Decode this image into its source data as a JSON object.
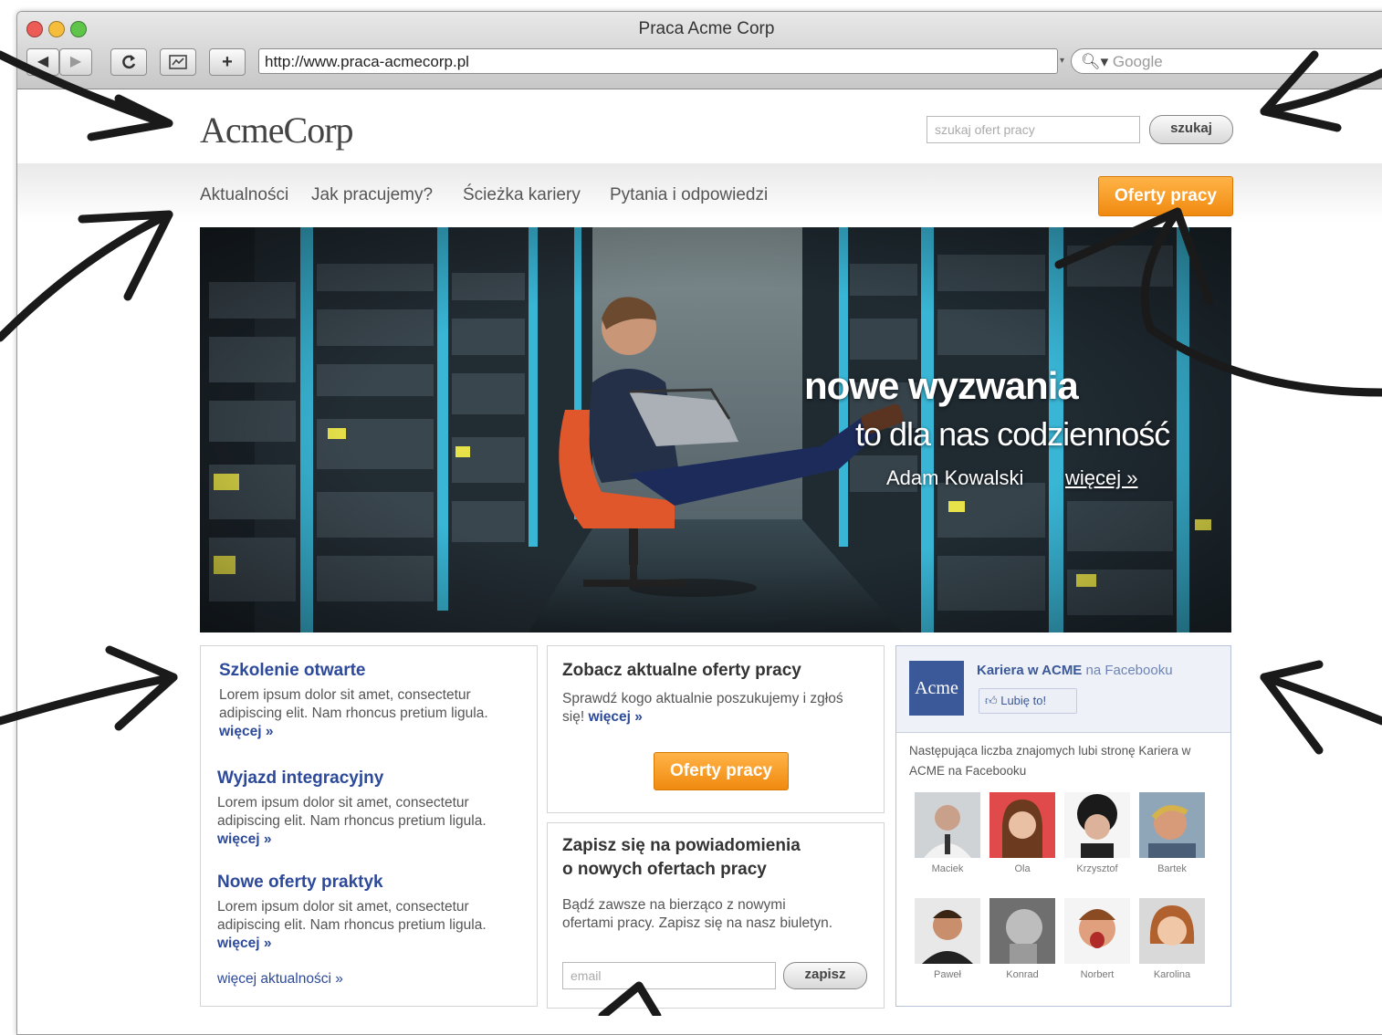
{
  "browser": {
    "window_title": "Praca Acme Corp",
    "url": "http://www.praca-acmecorp.pl",
    "search_placeholder": "Google",
    "back_label": "◀",
    "forward_label": "▶",
    "add_label": "+"
  },
  "header": {
    "logo": "AcmeCorp",
    "search_placeholder": "szukaj ofert pracy",
    "search_button": "szukaj"
  },
  "nav": {
    "items": [
      "Aktualności",
      "Jak pracujemy?",
      "Ścieżka kariery",
      "Pytania i odpowiedzi"
    ],
    "cta": "Oferty pracy"
  },
  "hero": {
    "headline": "nowe wyzwania",
    "subline": "to dla nas codzienność",
    "person": "Adam Kowalski",
    "more": "więcej »"
  },
  "news": {
    "items": [
      {
        "title": "Szkolenie otwarte",
        "text": "Lorem ipsum dolor sit amet, consectetur adipiscing elit. Nam rhoncus pretium ligula.",
        "more": "więcej »"
      },
      {
        "title": "Wyjazd integracyjny",
        "text": "Lorem ipsum dolor sit amet, consectetur adipiscing elit. Nam rhoncus pretium ligula.",
        "more": "więcej »"
      },
      {
        "title": "Nowe oferty praktyk",
        "text": "Lorem ipsum dolor sit amet, consectetur adipiscing elit. Nam rhoncus pretium ligula.",
        "more": "więcej »"
      }
    ],
    "all_news": "więcej aktualności »"
  },
  "offers": {
    "title": "Zobacz aktualne oferty pracy",
    "text": "Sprawdź kogo aktualnie poszukujemy i zgłoś się!",
    "more": "więcej »",
    "button": "Oferty pracy"
  },
  "newsletter": {
    "title_line1": "Zapisz się na powiadomienia",
    "title_line2": "o nowych ofertach pracy",
    "text": "Bądź zawsze na bierząco z nowymi ofertami pracy. Zapisz się na nasz biuletyn.",
    "email_placeholder": "email",
    "button": "zapisz"
  },
  "facebook": {
    "logo": "Acme",
    "page_name": "Kariera w ACME",
    "on_facebook": "na Facebooku",
    "like_button": "Lubię to!",
    "friends_text": "Następująca liczba znajomych lubi stronę Kariera w ACME na Facebooku",
    "friends": [
      "Maciek",
      "Ola",
      "Krzysztof",
      "Bartek",
      "Paweł",
      "Konrad",
      "Norbert",
      "Karolina"
    ]
  },
  "colors": {
    "accent_orange": "#f08a10",
    "link_blue": "#2d4a9a",
    "facebook_blue": "#3b5998"
  }
}
